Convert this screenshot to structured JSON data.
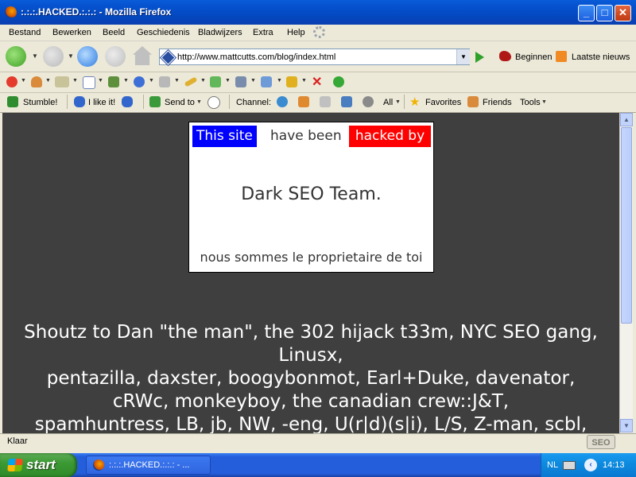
{
  "window": {
    "title": ":.:.:.HACKED.:.:.: - Mozilla Firefox"
  },
  "menu": [
    "Bestand",
    "Bewerken",
    "Beeld",
    "Geschiedenis",
    "Bladwijzers",
    "Extra",
    "Help"
  ],
  "nav": {
    "url": "http://www.mattcutts.com/blog/index.html",
    "bookmarks": [
      "Beginnen",
      "Laatste nieuws"
    ]
  },
  "stumble_toolbar": {
    "stumble": "Stumble!",
    "like": "I like it!",
    "send": "Send to",
    "channel": "Channel:",
    "all": "All",
    "favorites": "Favorites",
    "friends": "Friends",
    "tools": "Tools"
  },
  "page": {
    "this_site": "This site",
    "have_been": "have been",
    "hacked_by": "hacked by",
    "team": "Dark SEO Team.",
    "proprietaire": "nous sommes le proprietaire de toi",
    "shoutz_lines": [
      "Shoutz to Dan \"the man\", the 302 hijack t33m, NYC SEO gang,",
      "Linusx,",
      "pentazilla, daxster, boogybonmot, Earl+Duke, davenator,",
      "cRWc, monkeyboy, the canadian crew::J&T,",
      "spamhuntress, LB, jb, NW, -eng, U(r|d)(s|i), L/S, Z-man, scbl,"
    ]
  },
  "status": {
    "text": "Klaar",
    "badge": "SEO"
  },
  "taskbar": {
    "start": "start",
    "task": ":.:.:.HACKED.:.:.: - ...",
    "lang": "NL",
    "clock": "14:13"
  }
}
